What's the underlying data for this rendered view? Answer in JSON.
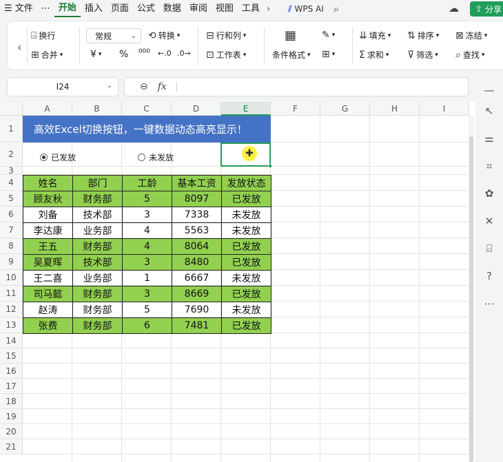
{
  "menubar": {
    "items": [
      {
        "label": "☰ 文件",
        "name": "menu-file"
      },
      {
        "label": "⋯",
        "name": "menu-more"
      },
      {
        "label": "开始",
        "name": "tab-home",
        "active": true
      },
      {
        "label": "插入",
        "name": "tab-insert"
      },
      {
        "label": "页面",
        "name": "tab-page"
      },
      {
        "label": "公式",
        "name": "tab-formula"
      },
      {
        "label": "数据",
        "name": "tab-data"
      },
      {
        "label": "审阅",
        "name": "tab-review"
      },
      {
        "label": "视图",
        "name": "tab-view"
      },
      {
        "label": "工具",
        "name": "tab-tools"
      }
    ],
    "wps_ai": "WPS AI",
    "share": "分享"
  },
  "ribbon": {
    "wrap": "换行",
    "merge": "合并",
    "number_format": "常规",
    "convert": "转换",
    "rows_cols": "行和列",
    "worksheet": "工作表",
    "cond_format": "条件格式",
    "fill": "填充",
    "sort": "排序",
    "freeze": "冻结",
    "sum": "求和",
    "filter": "筛选",
    "find": "查找",
    "currency": "¥",
    "percent": "%",
    "thousands": "⁰⁰⁰"
  },
  "formula": {
    "cell_ref": "I24",
    "fx": "fx",
    "content": ""
  },
  "columns": [
    "A",
    "B",
    "C",
    "D",
    "E",
    "F",
    "G",
    "H",
    "I"
  ],
  "rows": [
    "1",
    "2",
    "3",
    "4",
    "5",
    "6",
    "7",
    "8",
    "9",
    "10",
    "11",
    "12",
    "13",
    "14",
    "15",
    "16",
    "17",
    "18",
    "19",
    "20",
    "21"
  ],
  "sheet": {
    "title": "高效Excel切换按钮，一键数据动态高亮显示！",
    "radio_paid": "已发放",
    "radio_unpaid": "未发放",
    "headers": [
      "姓名",
      "部门",
      "工龄",
      "基本工资",
      "发放状态"
    ],
    "records": [
      {
        "name": "顾友秋",
        "dept": "财务部",
        "years": "5",
        "salary": "8097",
        "status": "已发放"
      },
      {
        "name": "刘备",
        "dept": "技术部",
        "years": "3",
        "salary": "7338",
        "status": "未发放"
      },
      {
        "name": "李达康",
        "dept": "业务部",
        "years": "4",
        "salary": "5563",
        "status": "未发放"
      },
      {
        "name": "王五",
        "dept": "财务部",
        "years": "4",
        "salary": "8064",
        "status": "已发放"
      },
      {
        "name": "吴夏晖",
        "dept": "技术部",
        "years": "3",
        "salary": "8480",
        "status": "已发放"
      },
      {
        "name": "王二喜",
        "dept": "业务部",
        "years": "1",
        "salary": "6667",
        "status": "未发放"
      },
      {
        "name": "司马懿",
        "dept": "财务部",
        "years": "3",
        "salary": "8669",
        "status": "已发放"
      },
      {
        "name": "赵涛",
        "dept": "财务部",
        "years": "5",
        "salary": "7690",
        "status": "未发放"
      },
      {
        "name": "张费",
        "dept": "财务部",
        "years": "6",
        "salary": "7481",
        "status": "已发放"
      }
    ]
  },
  "colors": {
    "accent": "#1f9d5a",
    "title_bg": "#4472c4",
    "highlight_green": "#92d050"
  }
}
